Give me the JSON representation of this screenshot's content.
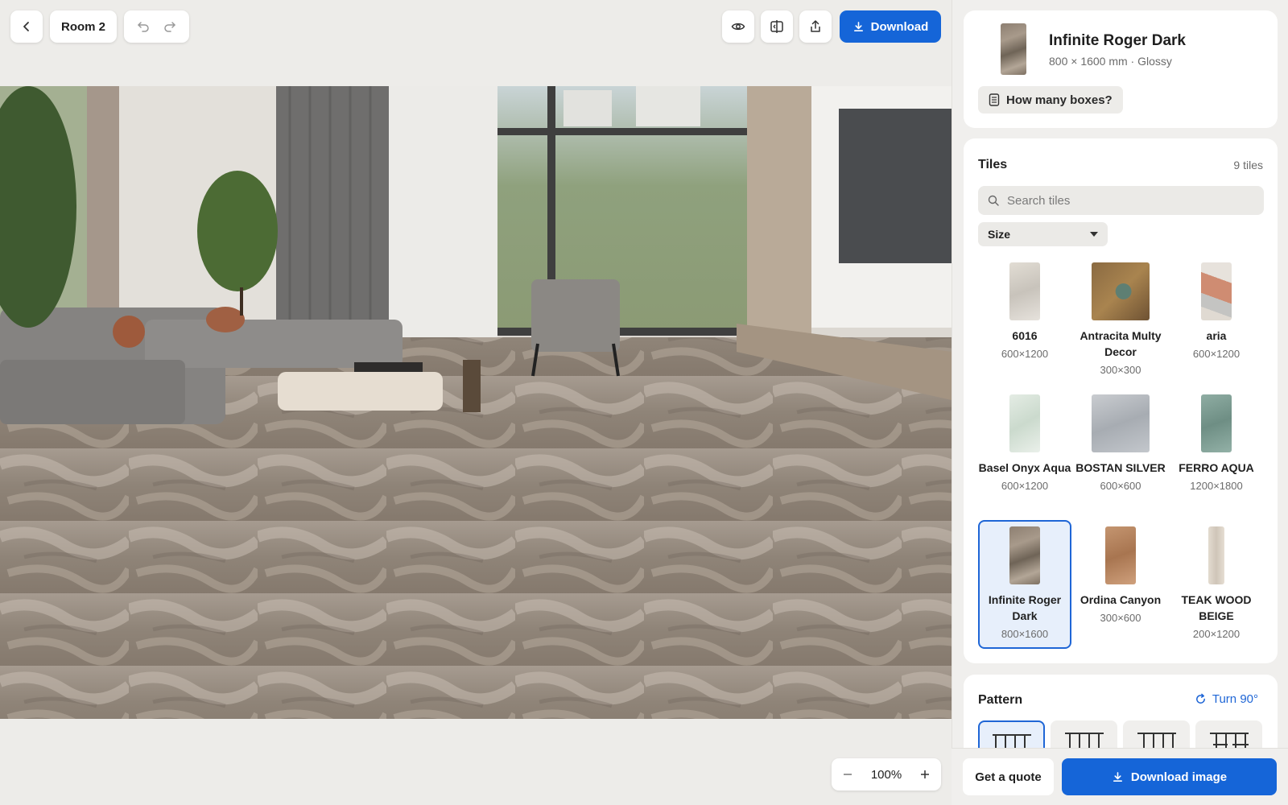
{
  "toolbar": {
    "room_label": "Room 2",
    "download_label": "Download"
  },
  "zoom": {
    "value": "100%"
  },
  "product": {
    "name": "Infinite Roger Dark",
    "meta": "800 × 1600 mm · Glossy",
    "boxes_label": "How many boxes?"
  },
  "tiles": {
    "title": "Tiles",
    "count": "9 tiles",
    "search_placeholder": "Search tiles",
    "size_filter": "Size",
    "items": [
      {
        "name": "6016",
        "size": "600×1200",
        "color": "#d9d6cf",
        "selected": false
      },
      {
        "name": "Antracita Multy Decor",
        "size": "300×300",
        "color": "#8a6a42",
        "selected": false
      },
      {
        "name": "aria",
        "size": "600×1200",
        "color": "#d6a38f",
        "selected": false
      },
      {
        "name": "Basel Onyx Aqua",
        "size": "600×1200",
        "color": "#d8e3da",
        "selected": false
      },
      {
        "name": "BOSTAN SILVER",
        "size": "600×600",
        "color": "#b7bcc1",
        "selected": false
      },
      {
        "name": "FERRO AQUA",
        "size": "1200×1800",
        "color": "#7f9f94",
        "selected": false
      },
      {
        "name": "Infinite Roger Dark",
        "size": "800×1600",
        "color": "#8d7f71",
        "selected": true
      },
      {
        "name": "Ordina Canyon",
        "size": "300×600",
        "color": "#b8865c",
        "selected": false
      },
      {
        "name": "TEAK WOOD BEIGE",
        "size": "200×1200",
        "color": "#ddd4c8",
        "selected": false
      }
    ]
  },
  "pattern": {
    "title": "Pattern",
    "turn_label": "Turn 90°"
  },
  "footer": {
    "quote_label": "Get a quote",
    "download_image_label": "Download image"
  },
  "colors": {
    "accent": "#1565d8",
    "selected_bg": "#e7effb"
  }
}
